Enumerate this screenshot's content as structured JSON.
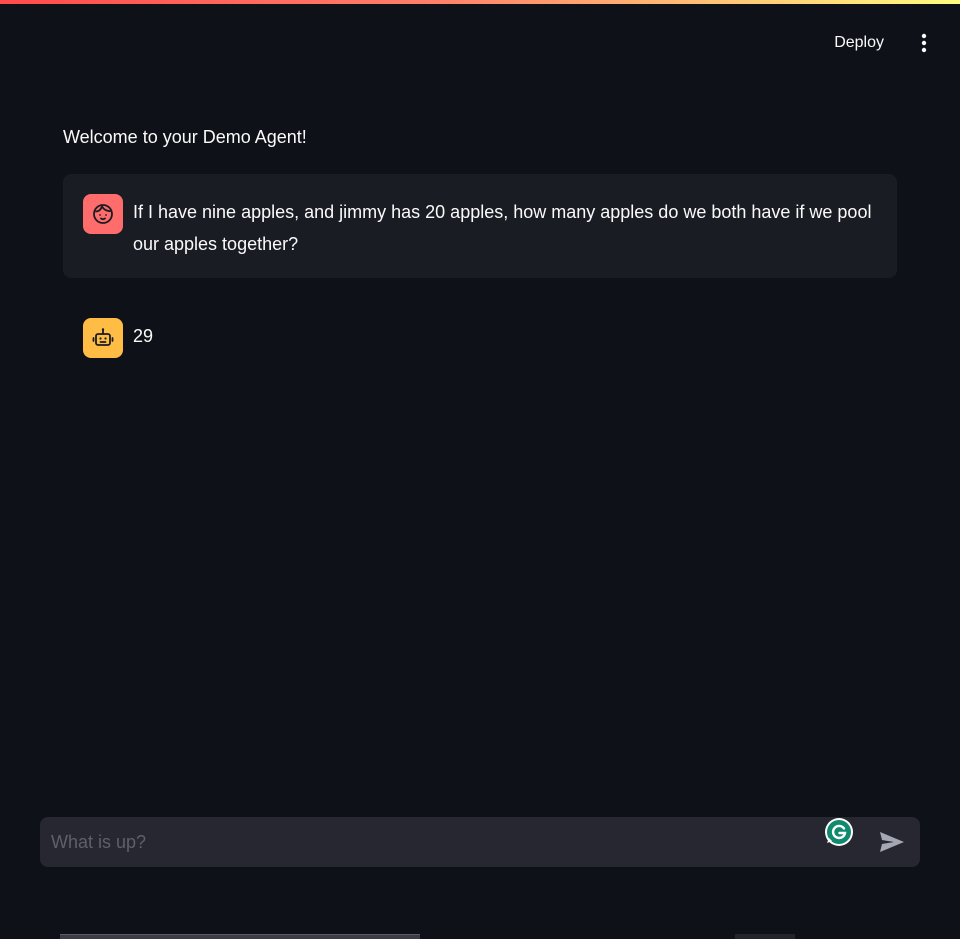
{
  "header": {
    "deploy_label": "Deploy",
    "menu_icon": "more-vertical-icon"
  },
  "welcome_text": "Welcome to your Demo Agent!",
  "messages": [
    {
      "role": "user",
      "avatar_icon": "face-icon",
      "avatar_color": "#ff6c6c",
      "text": "If I have nine apples, and jimmy has 20 apples, how many apples do we both have if we pool our apples together?"
    },
    {
      "role": "assistant",
      "avatar_icon": "robot-icon",
      "avatar_color": "#ffbd45",
      "text": "29"
    }
  ],
  "chat_input": {
    "placeholder": "What is up?",
    "value": "",
    "send_icon": "send-icon",
    "extension_icon": "grammarly-icon"
  },
  "colors": {
    "background": "#0e1117",
    "user_bubble": "#1a1c24",
    "input_bg": "#262730",
    "accent_gradient_start": "#ff4b4b",
    "accent_gradient_end": "#fffd80"
  }
}
